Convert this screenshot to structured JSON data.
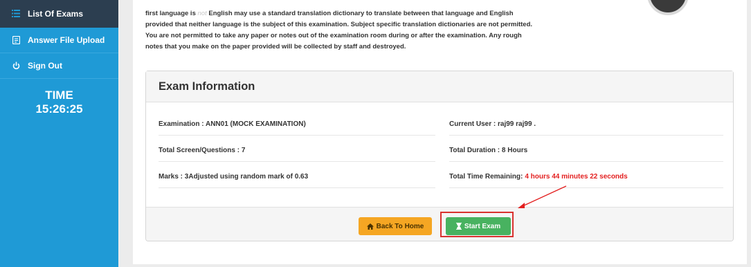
{
  "sidebar": {
    "items": [
      {
        "label": "List Of Exams",
        "icon": "list-icon"
      },
      {
        "label": "Answer File Upload",
        "icon": "file-icon"
      },
      {
        "label": "Sign Out",
        "icon": "power-icon"
      }
    ],
    "time_label": "TIME",
    "time_value": "15:26:25"
  },
  "instructions": {
    "line1_before": "first language is ",
    "line1_faint": "not",
    "line1_after": " English may use a standard translation dictionary to translate between that language and English",
    "line2": "provided that neither language is the subject of this examination. Subject specific translation dictionaries are not permitted.",
    "line3": "You are not permitted to take any paper or notes out of the examination room during or after the examination. Any rough",
    "line4": "notes that you make on the paper provided will be collected by staff and destroyed."
  },
  "exam_info": {
    "title": "Exam Information",
    "examination": "Examination : ANN01 (MOCK EXAMINATION)",
    "current_user": "Current User : raj99 raj99 .",
    "total_questions": "Total Screen/Questions : 7",
    "total_duration": "Total Duration : 8 Hours",
    "marks": "Marks : 3Adjusted using random mark of 0.63",
    "time_remaining_label": "Total Time Remaining:",
    "time_remaining_value": "4 hours 44 minutes 22 seconds"
  },
  "buttons": {
    "back_home": "Back To Home",
    "start_exam": "Start Exam"
  },
  "colors": {
    "sidebar": "#1f9ad6",
    "sidebar_active": "#2c3e50",
    "warning": "#f5a623",
    "success": "#48b260",
    "annotation": "#d9322f",
    "remaining": "#e32020"
  }
}
